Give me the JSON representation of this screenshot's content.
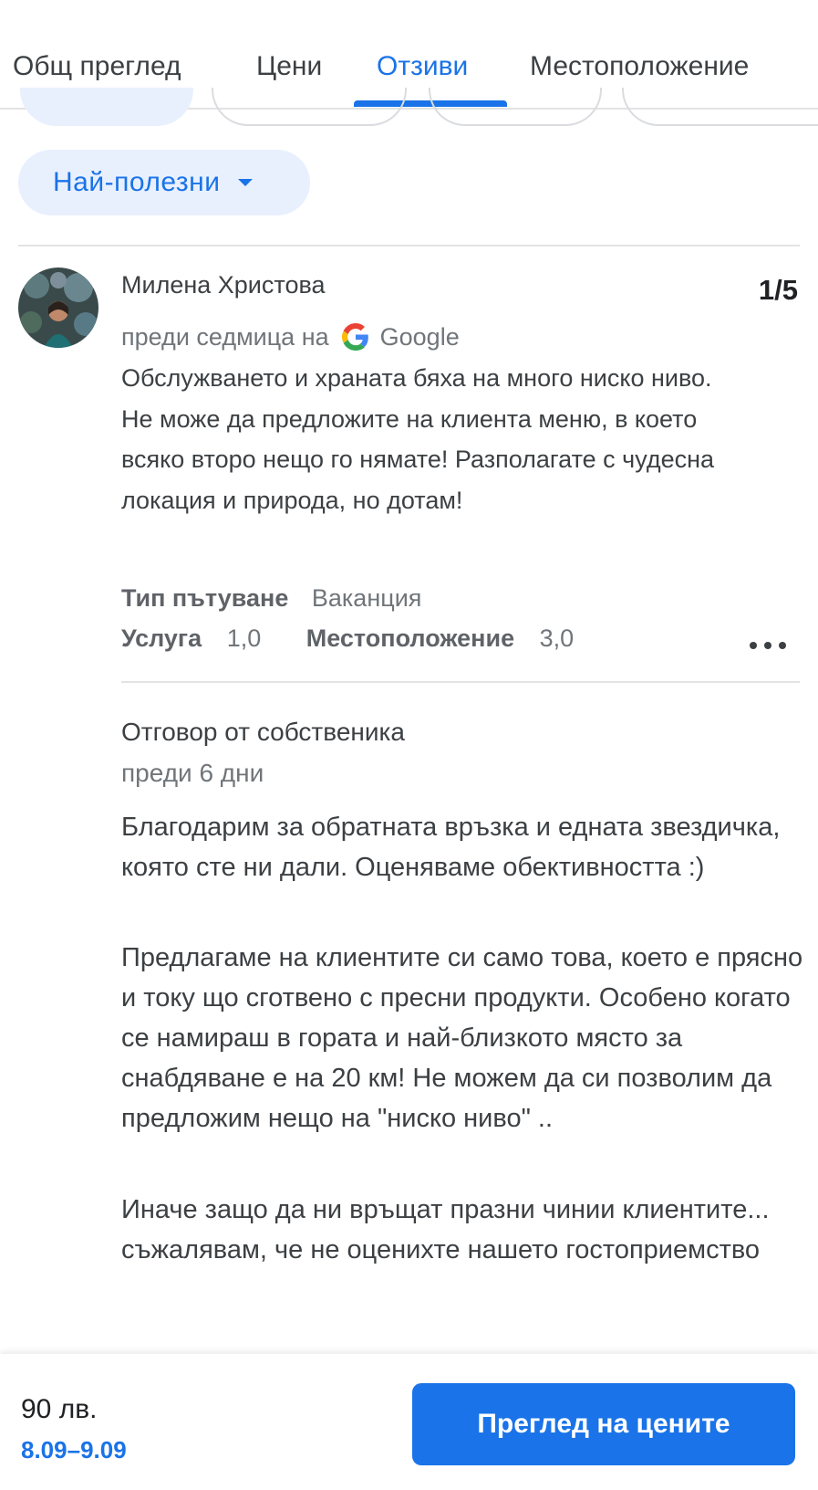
{
  "tabs": [
    {
      "label": "Общ преглед"
    },
    {
      "label": "Цени"
    },
    {
      "label": "Отзиви"
    },
    {
      "label": "Местоположение"
    }
  ],
  "active_tab": "Отзиви",
  "sort": {
    "label": "Най-полезни"
  },
  "review": {
    "author": "Милена Христова",
    "rating": "1/5",
    "time": "преди седмица на",
    "source": "Google",
    "text": "Обслужването и храната бяха на много ниско ниво. Не може да предложите на клиента меню, в което всяко второ нещо го нямате! Разполагате с чудесна локация и природа, но дотам!",
    "trip_type_label": "Тип пътуване",
    "trip_type_value": "Ваканция",
    "service_label": "Услуга",
    "service_value": "1,0",
    "location_label": "Местоположение",
    "location_value": "3,0"
  },
  "owner_reply": {
    "title": "Отговор от собственика",
    "time": "преди 6 дни",
    "paragraphs": [
      "Благодарим за обратната връзка и едната звездичка, която сте ни дали. Оценяваме обективността :)",
      "Предлагаме на клиентите си само това, което е прясно и току що сготвено с пресни продукти. Особено когато се намираш в гората и най-близкото място за снабдяване е на 20 км! Не можем да си позволим да предложим нещо на \"ниско ниво\" ..",
      "Иначе защо да ни връщат празни чинии клиентите... съжалявам, че не оценихте нашето гостоприемство"
    ]
  },
  "bottom_bar": {
    "price": "90 лв.",
    "dates": "8.09–9.09",
    "button_label": "Преглед на цените"
  },
  "colors": {
    "accent": "#1a73e8",
    "chip_bg": "#e8f0fe",
    "text": "#3c4043",
    "muted": "#70757a"
  },
  "icons": {
    "sort": "caret-down-icon",
    "source": "google-g-icon",
    "more": "more-horizontal-icon"
  }
}
